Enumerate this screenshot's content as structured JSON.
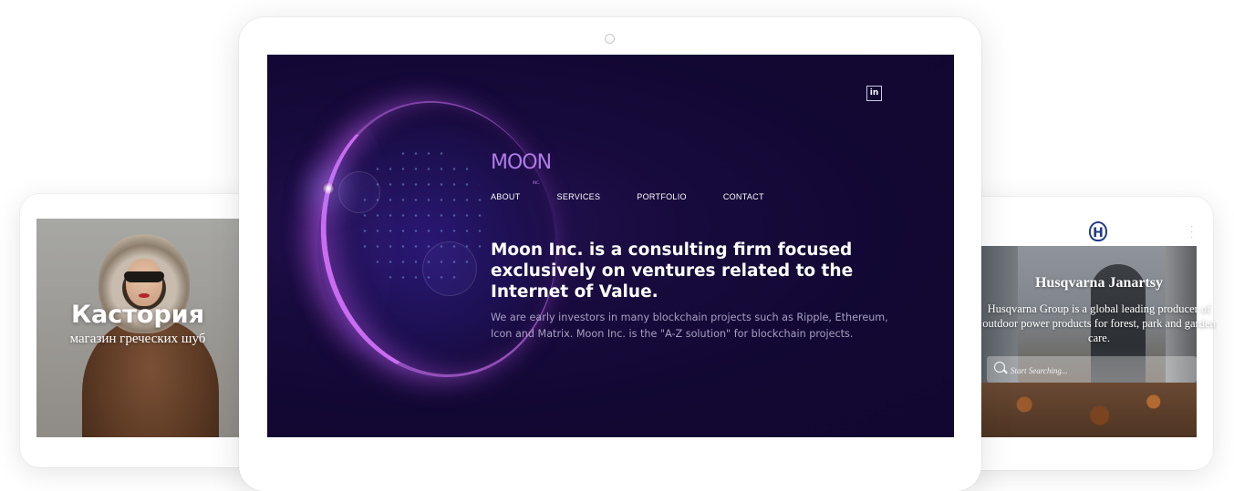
{
  "left_site": {
    "title": "Кастория",
    "subtitle": "магазин греческих шуб"
  },
  "center_site": {
    "logo_text": "MOON",
    "logo_sub": "INC.",
    "linkedin_icon_label": "in",
    "nav": [
      "ABOUT",
      "SERVICES",
      "PORTFOLIO",
      "CONTACT"
    ],
    "headline": "Moon Inc. is a consulting firm focused exclusively on ventures related to the Internet of Value.",
    "subtext": "We are early investors in many blockchain projects such as Ripple, Ethereum, Icon and Matrix. Moon Inc. is the \"A-Z solution\" for blockchain projects."
  },
  "right_site": {
    "logo_glyph": "H",
    "title": "Husqvarna Janartsy",
    "description": "Husqvarna Group is a global leading producer of outdoor power products for forest, park and garden care.",
    "search_placeholder": "Start Searching..."
  },
  "colors": {
    "moon_background": "#140937",
    "moon_logo": "#b07be8",
    "moon_subtext": "#a79fc2",
    "husqvarna_blue": "#213b86"
  },
  "icons": [
    "linkedin-icon",
    "husqvarna-logo-icon",
    "search-icon",
    "camera-icon"
  ]
}
